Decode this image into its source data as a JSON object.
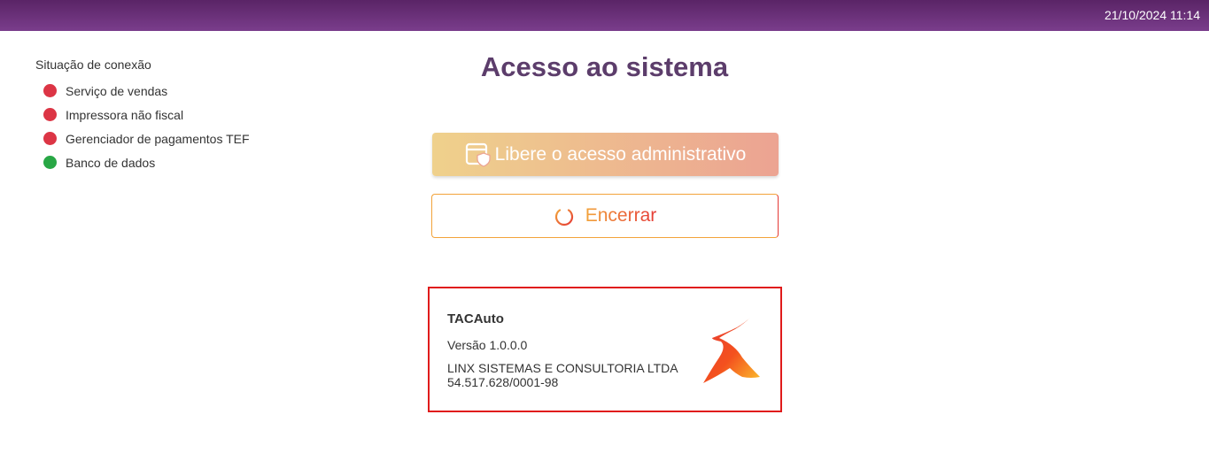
{
  "header": {
    "datetime": "21/10/2024 11:14"
  },
  "connection": {
    "title": "Situação de conexão",
    "items": [
      {
        "label": "Serviço de vendas",
        "status": "offline",
        "color": "#dc3545"
      },
      {
        "label": "Impressora não fiscal",
        "status": "offline",
        "color": "#dc3545"
      },
      {
        "label": "Gerenciador de pagamentos TEF",
        "status": "offline",
        "color": "#dc3545"
      },
      {
        "label": "Banco de dados",
        "status": "online",
        "color": "#28a745"
      }
    ]
  },
  "main": {
    "title": "Acesso ao sistema",
    "admin_button": {
      "label": "Libere o acesso administrativo",
      "icon": "shield-window-icon"
    },
    "close_button": {
      "label": "Encerrar",
      "icon": "power-icon"
    }
  },
  "about": {
    "app_name": "TACAuto",
    "version": "Versão 1.0.0.0",
    "company": "LINX SISTEMAS E CONSULTORIA LTDA",
    "cnpj": "54.517.628/0001-98",
    "logo": "linx-logo"
  },
  "colors": {
    "header_start": "#5a2466",
    "header_end": "#7a3d8c",
    "title": "#5c3d6b",
    "accent_orange": "#f2a33a",
    "accent_red": "#e53935",
    "highlight_border": "#e01b1b"
  }
}
